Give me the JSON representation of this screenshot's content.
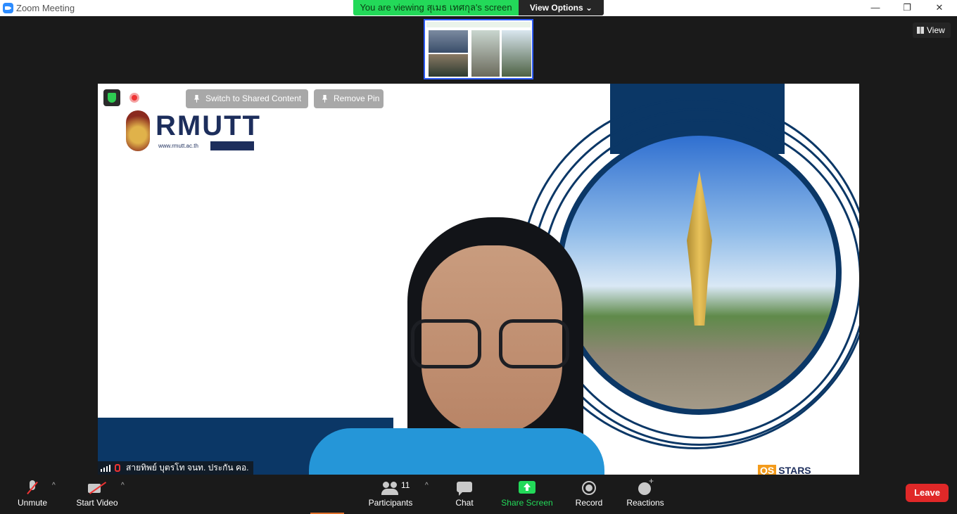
{
  "window": {
    "title": "Zoom Meeting",
    "minimize_glyph": "—",
    "restore_glyph": "❐",
    "close_glyph": "✕"
  },
  "share_banner": {
    "viewing_text": "You are viewing สุเมธ เทศกุล's screen",
    "view_options_label": "View Options",
    "chevron_glyph": "⌄"
  },
  "view_button": {
    "label": "View"
  },
  "video_controls": {
    "switch_label": "Switch to Shared Content",
    "remove_pin_label": "Remove Pin"
  },
  "video": {
    "background_logo": "RMUTT",
    "background_logo_sub": "www.rmutt.ac.th",
    "participant_name": "สายทิพย์  บุตรโท จนท. ประกัน คอ.",
    "qs_badge": "QS",
    "qs_text": "STARS"
  },
  "toolbar": {
    "unmute_label": "Unmute",
    "start_video_label": "Start Video",
    "participants_label": "Participants",
    "participants_count": "11",
    "chat_label": "Chat",
    "share_screen_label": "Share Screen",
    "record_label": "Record",
    "reactions_label": "Reactions",
    "leave_label": "Leave",
    "caret_glyph": "^"
  },
  "colors": {
    "banner_green": "#23d959",
    "leave_red": "#e02828",
    "brand_blue": "#0b3766"
  }
}
